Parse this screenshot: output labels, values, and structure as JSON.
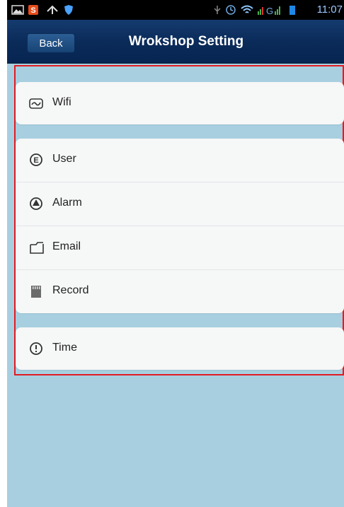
{
  "status_bar": {
    "time": "11:07",
    "icons_left": [
      "picture-icon",
      "app-s-icon",
      "arrow-icon",
      "shield-icon"
    ],
    "icons_right": [
      "usb-icon",
      "alarm-icon",
      "wifi-icon",
      "signal-icon",
      "battery-icon"
    ]
  },
  "header": {
    "back_label": "Back",
    "title": "Wrokshop Setting"
  },
  "settings": {
    "wifi": {
      "label": "Wifi",
      "icon": "wave-icon"
    },
    "items": [
      {
        "label": "User",
        "icon": "user-icon"
      },
      {
        "label": "Alarm",
        "icon": "alarm-bell-icon"
      },
      {
        "label": "Email",
        "icon": "email-icon"
      },
      {
        "label": "Record",
        "icon": "sd-card-icon"
      }
    ],
    "time": {
      "label": "Time",
      "icon": "clock-icon"
    }
  },
  "colors": {
    "background": "#a7cfe0",
    "header": "#0c2c5a",
    "outline": "#e11b22"
  }
}
